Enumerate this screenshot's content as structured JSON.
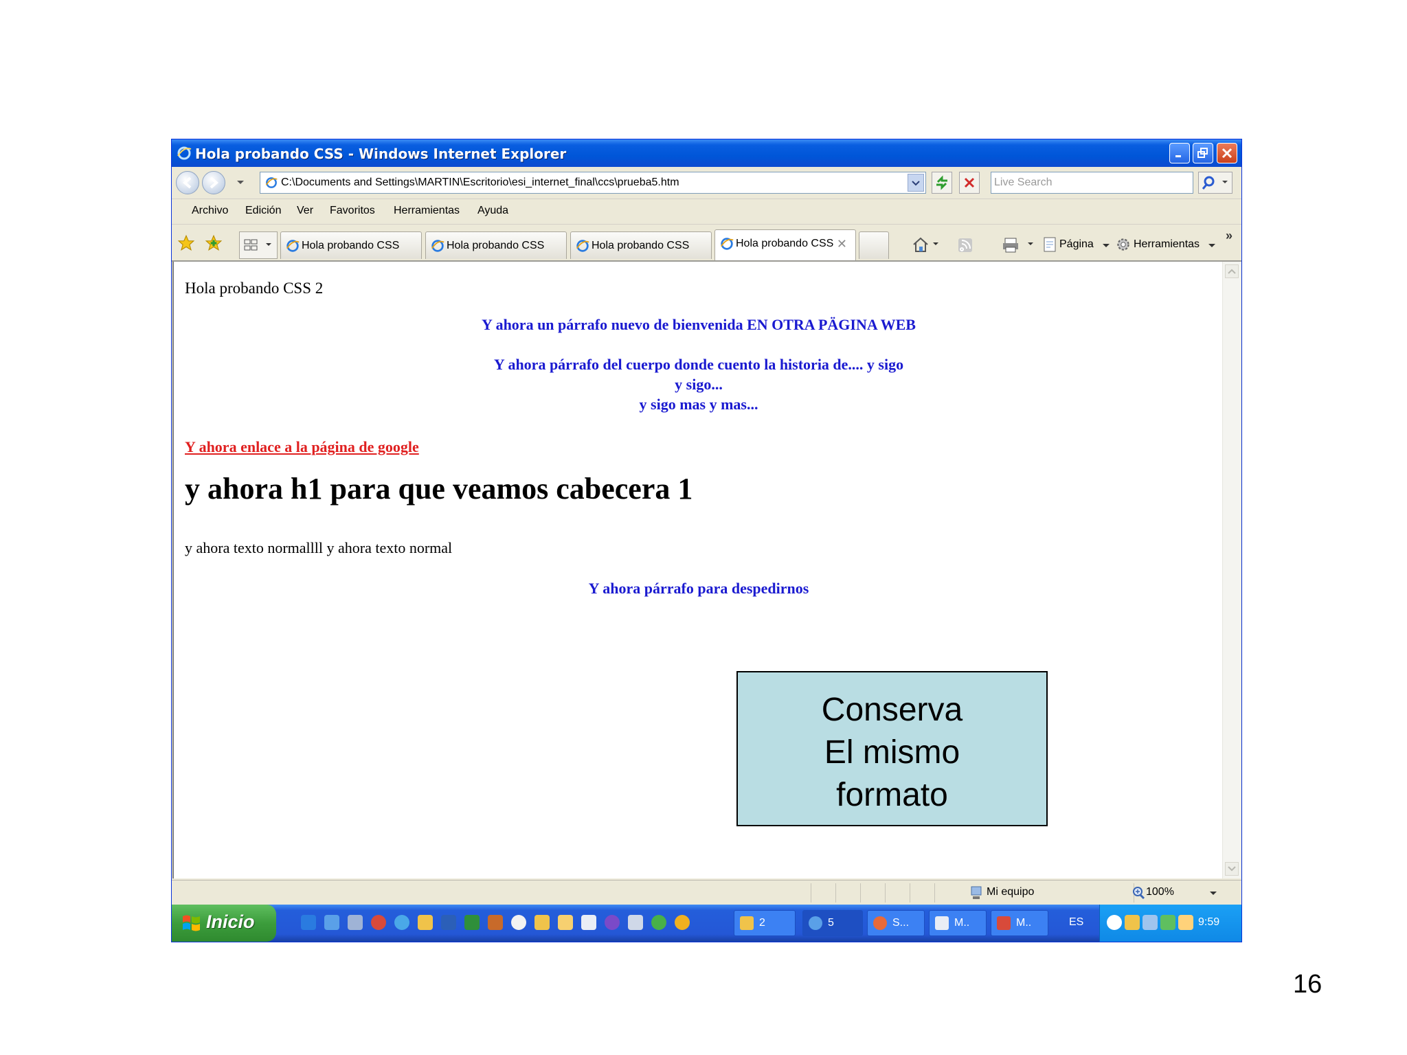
{
  "window": {
    "title": "Hola probando CSS - Windows Internet Explorer"
  },
  "address_bar": {
    "url": "C:\\Documents and Settings\\MARTIN\\Escritorio\\esi_internet_final\\ccs\\prueba5.htm",
    "search_placeholder": "Live Search"
  },
  "menu": {
    "items": [
      "Archivo",
      "Edición",
      "Ver",
      "Favoritos",
      "Herramientas",
      "Ayuda"
    ]
  },
  "tabs": [
    {
      "label": "Hola probando CSS",
      "active": false
    },
    {
      "label": "Hola probando CSS",
      "active": false
    },
    {
      "label": "Hola probando CSS",
      "active": false
    },
    {
      "label": "Hola probando CSS",
      "active": true
    }
  ],
  "commands": {
    "page_label": "Página",
    "tools_label": "Herramientas"
  },
  "page": {
    "title_line": "Hola probando CSS 2",
    "welcome": "Y ahora un párrafo nuevo de bienvenida EN OTRA PÄGINA WEB",
    "body_line1": "Y ahora párrafo del cuerpo donde cuento la historia de.... y sigo",
    "body_line2": "y sigo...",
    "body_line3": "y sigo mas y mas...",
    "link": "Y ahora enlace a la página de google",
    "h1": "y ahora h1 para que veamos cabecera 1",
    "normal_text": "y ahora texto normallll y ahora texto normal",
    "goodbye": "Y ahora párrafo para despedirnos"
  },
  "status_bar": {
    "zone": "Mi equipo",
    "zoom": "100%"
  },
  "taskbar": {
    "start_label": "Inicio",
    "buttons": [
      {
        "label": "2"
      },
      {
        "label": "5"
      },
      {
        "label": "S..."
      },
      {
        "label": "M.."
      },
      {
        "label": "M.."
      }
    ],
    "language": "ES",
    "time": "9:59"
  },
  "callout": {
    "line1": "Conserva",
    "line2": "El mismo",
    "line3": "formato"
  },
  "slide_number": "16"
}
